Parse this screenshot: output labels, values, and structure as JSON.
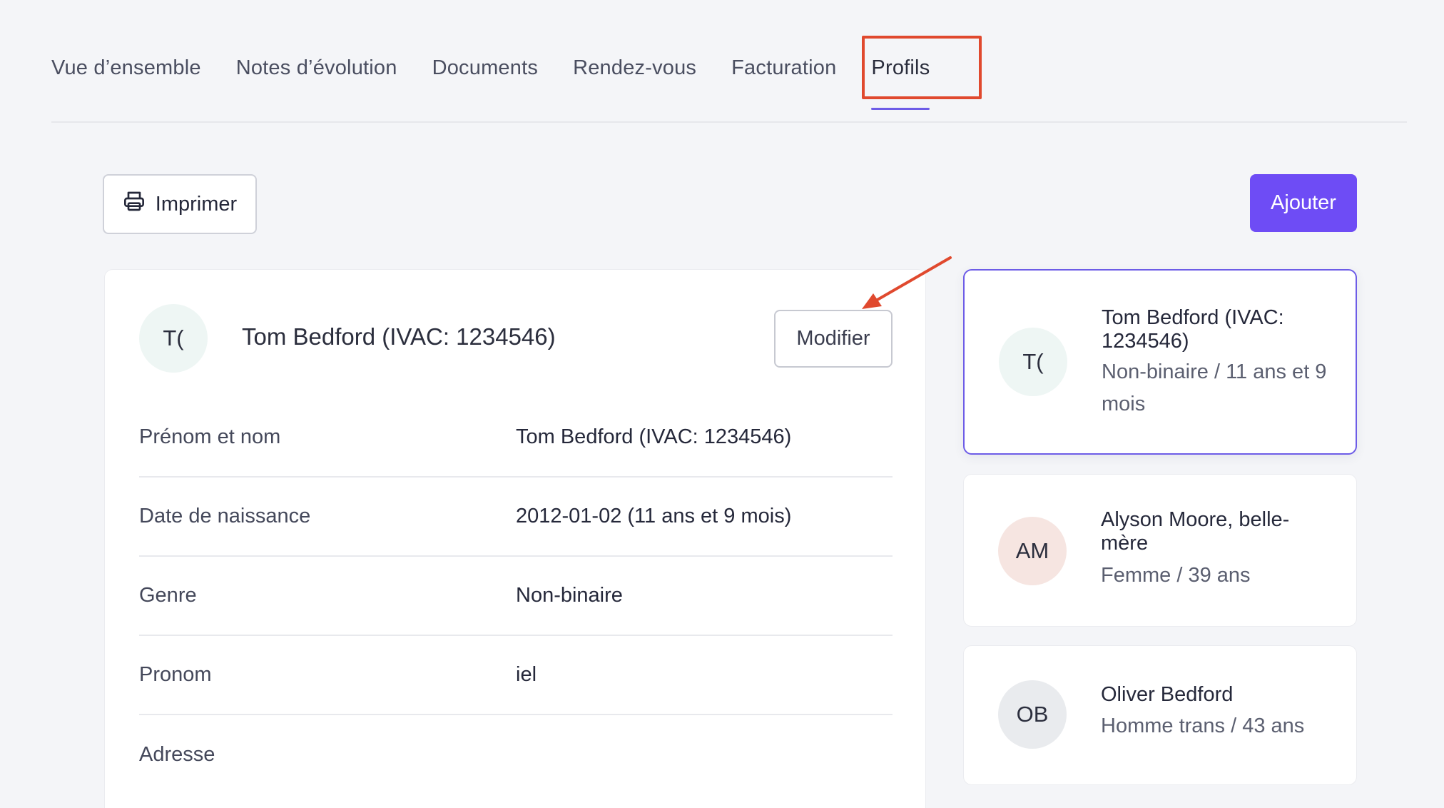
{
  "tabs": [
    {
      "label": "Vue d’ensemble"
    },
    {
      "label": "Notes d’évolution"
    },
    {
      "label": "Documents"
    },
    {
      "label": "Rendez-vous"
    },
    {
      "label": "Facturation"
    },
    {
      "label": "Profils",
      "active": true
    }
  ],
  "toolbar": {
    "print_label": "Imprimer",
    "add_label": "Ajouter"
  },
  "profile": {
    "initials": "T(",
    "name": "Tom Bedford (IVAC: 1234546)",
    "edit_label": "Modifier",
    "fields": [
      {
        "label": "Prénom et nom",
        "value": "Tom Bedford (IVAC: 1234546)"
      },
      {
        "label": "Date de naissance",
        "value": "2012-01-02 (11 ans et 9 mois)"
      },
      {
        "label": "Genre",
        "value": "Non-binaire"
      },
      {
        "label": "Pronom",
        "value": "iel"
      },
      {
        "label": "Adresse",
        "value": ""
      }
    ]
  },
  "profiles": [
    {
      "initials": "T(",
      "name": "Tom Bedford (IVAC: 1234546)",
      "details": "Non-binaire / 11 ans et 9 mois",
      "avatar_color": "#eef6f4",
      "selected": true
    },
    {
      "initials": "AM",
      "name": "Alyson Moore, belle-mère",
      "details": "Femme / 39 ans",
      "avatar_color": "#f6e5e1"
    },
    {
      "initials": "OB",
      "name": "Oliver Bedford",
      "details": "Homme trans / 43 ans",
      "avatar_color": "#e9ebee"
    }
  ],
  "colors": {
    "accent": "#6e4cf5",
    "annotation": "#e0492e"
  }
}
